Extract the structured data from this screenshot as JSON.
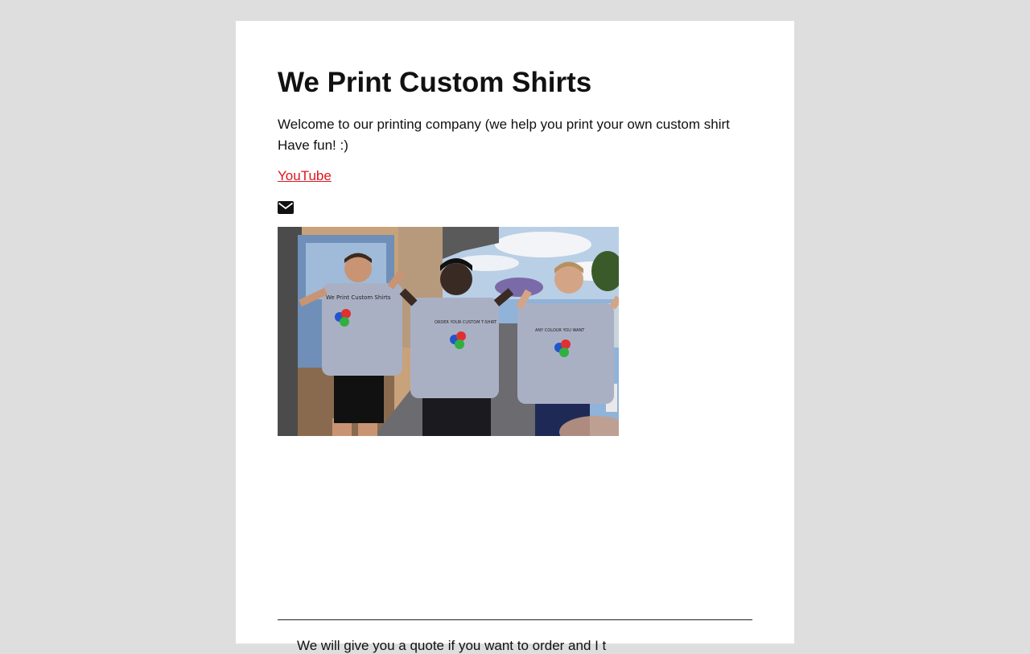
{
  "page": {
    "title": "We Print Custom Shirts",
    "intro_line1": "Welcome to our printing company (we help you print your own custom shirt",
    "intro_line2": "Have fun! :)",
    "youtube_link": "YouTube",
    "footer_text": "We will give you a quote if you want to order and I t"
  },
  "icons": {
    "mail": "envelope-icon"
  },
  "photo": {
    "alt": "Three boys showing the backs of their custom printed t-shirts",
    "shirt_text_line1": "We Print Custom Shirts",
    "shirt_text_line2": "ORDER YOUR CUSTOM T-SHIRT",
    "shirt_text_line3": "ANY COLOUR YOU WANT"
  },
  "colors": {
    "background": "#dedede",
    "card": "#ffffff",
    "link": "#e0141e",
    "text": "#111111"
  }
}
